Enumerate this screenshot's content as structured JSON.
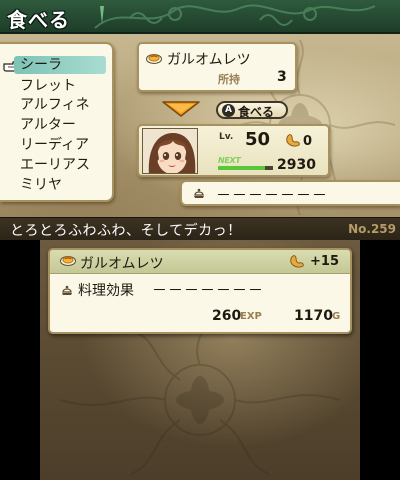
{
  "header": {
    "title": "食べる"
  },
  "characters": {
    "items": [
      {
        "name": "シーラ",
        "selected": true
      },
      {
        "name": "フレット",
        "selected": false
      },
      {
        "name": "アルフィネ",
        "selected": false
      },
      {
        "name": "アルター",
        "selected": false
      },
      {
        "name": "リーディア",
        "selected": false
      },
      {
        "name": "エーリアス",
        "selected": false
      },
      {
        "name": "ミリヤ",
        "selected": false
      }
    ]
  },
  "item": {
    "name": "ガルオムレツ",
    "owned_label": "所持",
    "owned_count": "3"
  },
  "eat_button": {
    "label": "食べる",
    "key": "A"
  },
  "character_info": {
    "lv_label": "Lv.",
    "level": "50",
    "stomach": "0",
    "next_label": "NEXT",
    "next_exp": "2930",
    "next_progress": 0.85
  },
  "effect_top": {
    "dashes": "－－－－－－－"
  },
  "description": {
    "text": "とろとろふわふわ、そしてデカっ！",
    "number": "No.259"
  },
  "detail": {
    "name": "ガルオムレツ",
    "stomach_gain": "+15",
    "effect_label": "料理効果",
    "effect_dashes": "－－－－－－－",
    "exp": "260",
    "exp_unit": "EXP",
    "gold": "1170",
    "gold_unit": "G"
  },
  "colors": {
    "title_bar": "#2f5a3d",
    "selected_row": "#7dc3b6",
    "panel_bg": "#fbf8e8",
    "panel_border": "#a6915f",
    "next_bar": "#59c73a"
  }
}
